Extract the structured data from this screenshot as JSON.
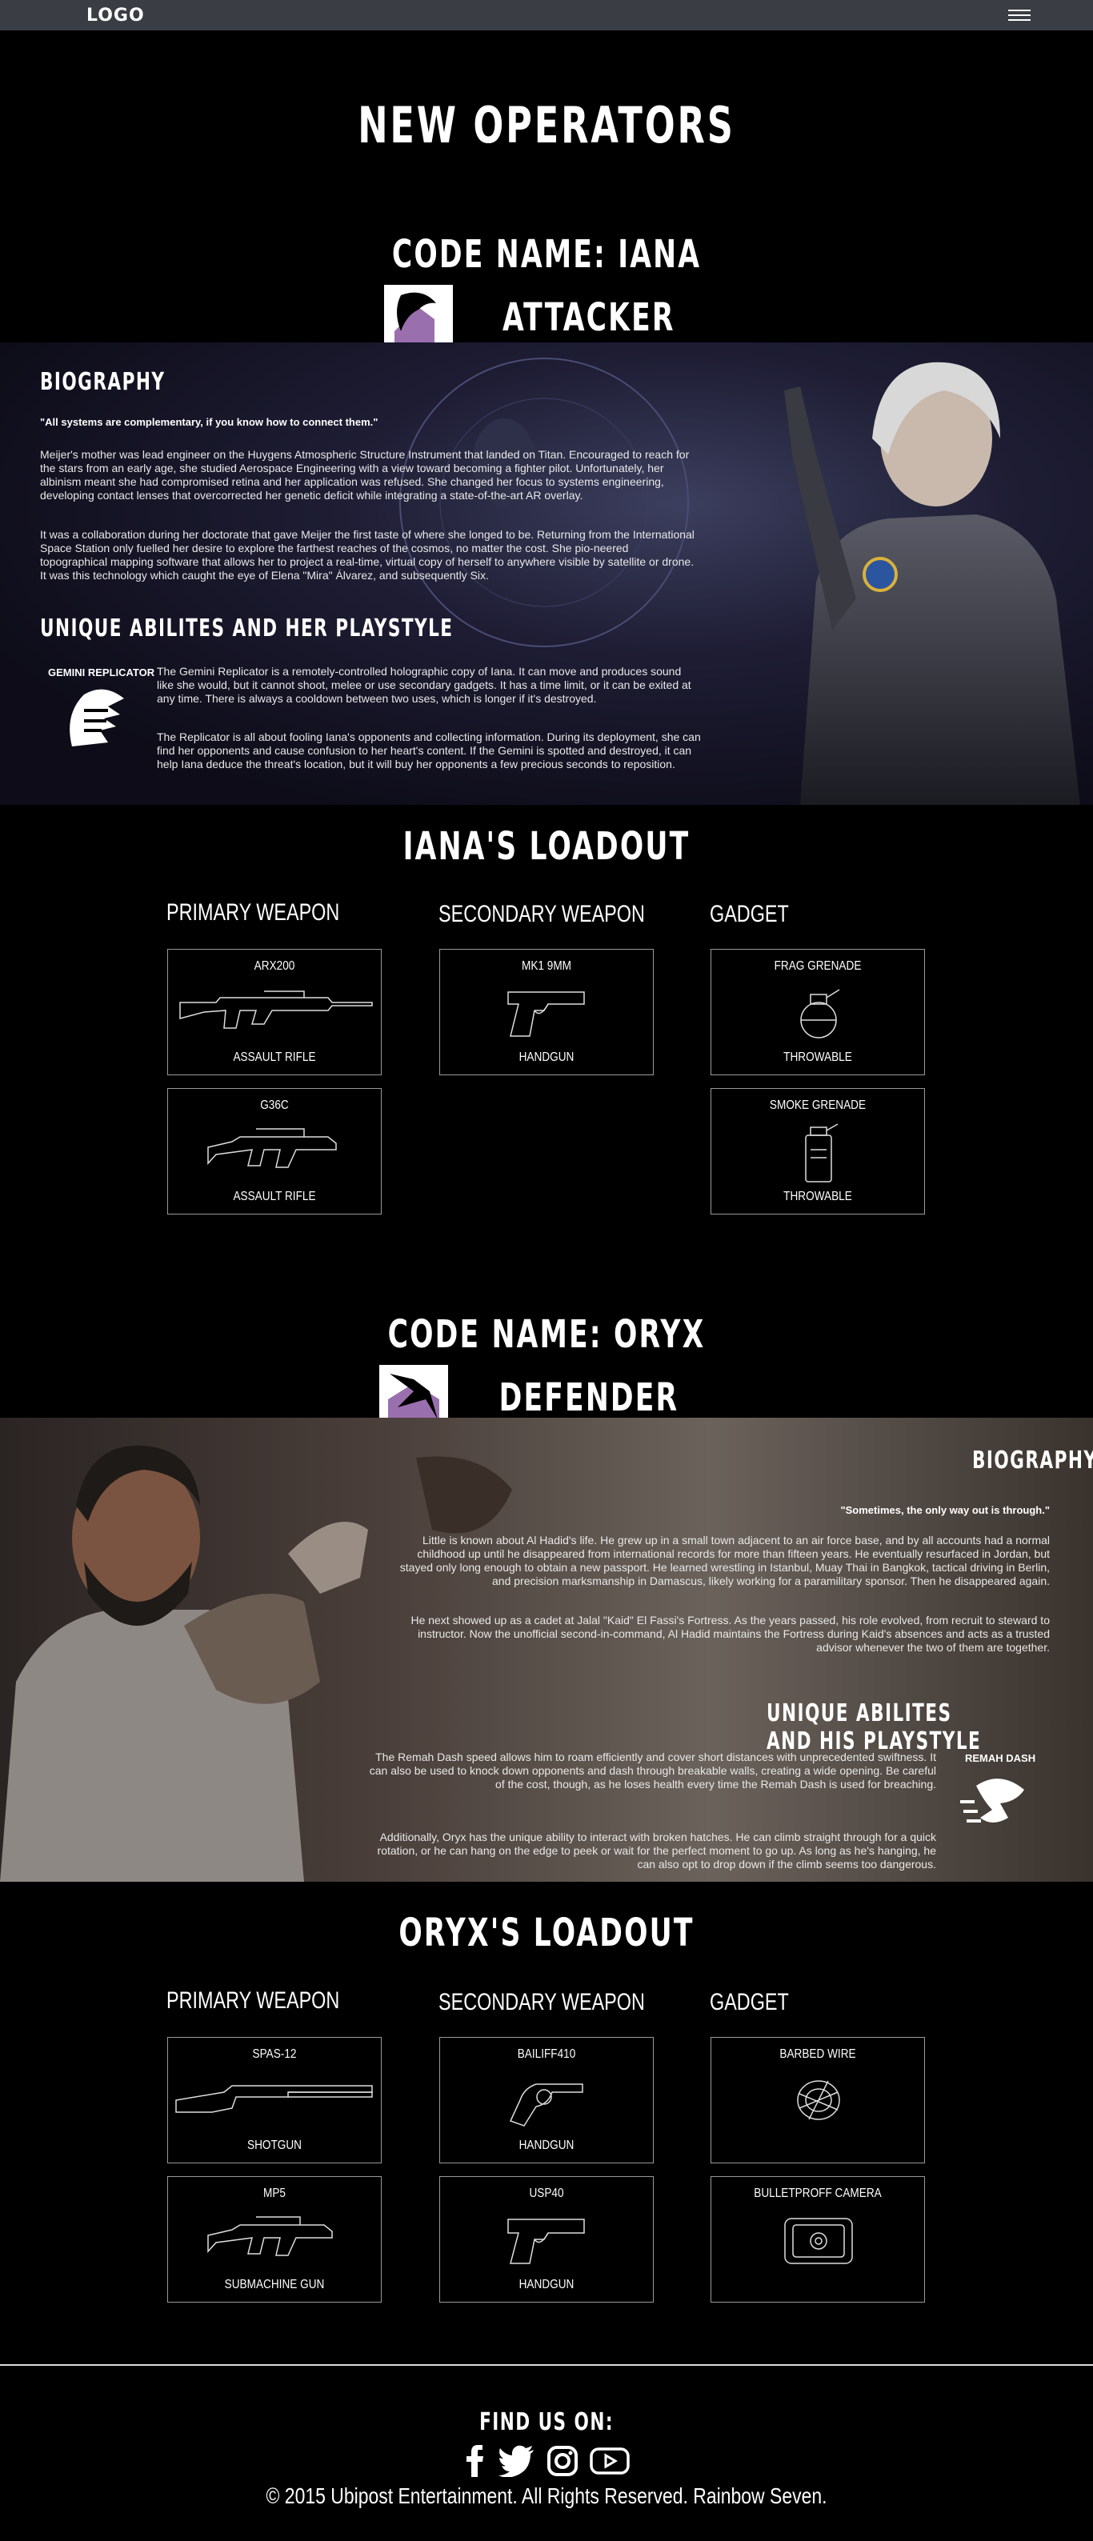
{
  "nav": {
    "logo": "LOGO"
  },
  "page_title": "NEW OPERATORS",
  "iana": {
    "code_name": "CODE NAME: IANA",
    "role": "ATTACKER",
    "bio_title": "BIOGRAPHY",
    "quote": "\"All systems are complementary, if you know how to connect them.\"",
    "bio_p1": "Meijer's mother was lead engineer on the Huygens Atmospheric Structure Instrument that landed on Titan. Encouraged to reach for the stars from an early age, she studied Aerospace Engineering with a view toward becoming a fighter pilot. Unfortunately, her albinism meant she had compromised retina and her application was refused. She changed her focus to systems engineering, developing contact lenses that overcorrected her genetic deficit while integrating a state-of-the-art AR overlay.",
    "bio_p2": "It was a collaboration during her doctorate that gave Meijer the first taste of where she longed to be. Returning from the International Space Station only fuelled her desire to explore the farthest reaches of the cosmos, no matter the cost. She pio-neered topographical mapping software that allows her to project a real-time, virtual copy of herself to anywhere visible by satellite or drone. It was this technology which caught the eye of Elena \"Mira\" Álvarez, and subsequently Six.",
    "ability_title": "UNIQUE ABILITES AND HER PLAYSTYLE",
    "ability_name": "GEMINI REPLICATOR",
    "ability_p1": "The Gemini Replicator is a remotely-controlled holographic copy of Iana. It can move and produces sound like she would, but it cannot shoot, melee or use secondary gadgets. It has a time limit, or it can be exited at any time. There is always a cooldown between two uses, which is longer if it's destroyed.",
    "ability_p2": "The Replicator is all about fooling Iana's opponents and collecting information. During its deployment, she can find her opponents and cause confusion to her heart's content. If the Gemini is spotted and destroyed, it can help Iana deduce the threat's location, but it will buy her opponents a few precious seconds to reposition.",
    "loadout_title": "IANA'S LOADOUT",
    "cols": [
      "PRIMARY WEAPON",
      "SECONDARY WEAPON",
      "GADGET"
    ],
    "cards": [
      {
        "name": "ARX200",
        "type": "ASSAULT RIFLE",
        "icon": "assault-rifle-icon"
      },
      {
        "name": "MK1 9MM",
        "type": "HANDGUN",
        "icon": "handgun-icon"
      },
      {
        "name": "FRAG GRENADE",
        "type": "THROWABLE",
        "icon": "frag-grenade-icon"
      },
      {
        "name": "G36C",
        "type": "ASSAULT RIFLE",
        "icon": "assault-rifle-icon"
      },
      {
        "name": "SMOKE GRENADE",
        "type": "THROWABLE",
        "icon": "smoke-grenade-icon"
      }
    ]
  },
  "oryx": {
    "code_name": "CODE NAME: ORYX",
    "role": "DEFENDER",
    "bio_title": "BIOGRAPHY",
    "quote": "\"Sometimes, the only way out is through.\"",
    "bio_p1": "Little is known about Al Hadid's life. He grew up in a small town adjacent to an air force base, and by all accounts had a normal childhood up until he disappeared from international records for more than fifteen years. He eventually resurfaced in Jordan, but stayed only long enough to obtain a new passport. He learned wrestling in Istanbul, Muay Thai in Bangkok, tactical driving in Berlin, and precision marksmanship in Damascus, likely working for a paramilitary sponsor. Then he disappeared again.",
    "bio_p2": "He next showed up as a cadet at Jalal \"Kaid\" El Fassi's Fortress. As the years passed, his role evolved, from recruit to steward to instructor. Now the unofficial second-in-command, Al Hadid maintains the Fortress during Kaid's absences and acts as a trusted advisor whenever the two of them are together.",
    "ability_title": "UNIQUE ABILITES AND HIS PLAYSTYLE",
    "ability_name": "REMAH DASH",
    "ability_p1": "The Remah Dash speed allows him to roam efficiently and cover short distances with unprecedented swiftness. It can also be used to knock down opponents and dash through breakable walls, creating a wide opening. Be careful of the cost, though, as he loses health every time the Remah Dash is used for breaching.",
    "ability_p2": "Additionally, Oryx has the unique ability to interact with broken hatches. He can climb straight through for a quick rotation, or he can hang on the edge to peek or wait for the perfect moment to go up. As long as he's hanging, he can also opt to drop down if the climb seems too dangerous.",
    "loadout_title": "ORYX'S LOADOUT",
    "cols": [
      "PRIMARY WEAPON",
      "SECONDARY WEAPON",
      "GADGET"
    ],
    "cards": [
      {
        "name": "SPAS-12",
        "type": "SHOTGUN",
        "icon": "shotgun-icon"
      },
      {
        "name": "BAILIFF410",
        "type": "HANDGUN",
        "icon": "revolver-icon"
      },
      {
        "name": "BARBED WIRE",
        "type": "",
        "icon": "barbed-wire-icon"
      },
      {
        "name": "MP5",
        "type": "SUBMACHINE GUN",
        "icon": "smg-icon"
      },
      {
        "name": "USP40",
        "type": "HANDGUN",
        "icon": "handgun-icon"
      },
      {
        "name": "BULLETPROFF CAMERA",
        "type": "",
        "icon": "camera-icon"
      }
    ]
  },
  "footer": {
    "find_us": "FIND US ON:",
    "socials": [
      "facebook-icon",
      "twitter-icon",
      "instagram-icon",
      "youtube-icon"
    ],
    "copyright": "© 2015 Ubipost Entertainment. All Rights Reserved. Rainbow Seven."
  }
}
